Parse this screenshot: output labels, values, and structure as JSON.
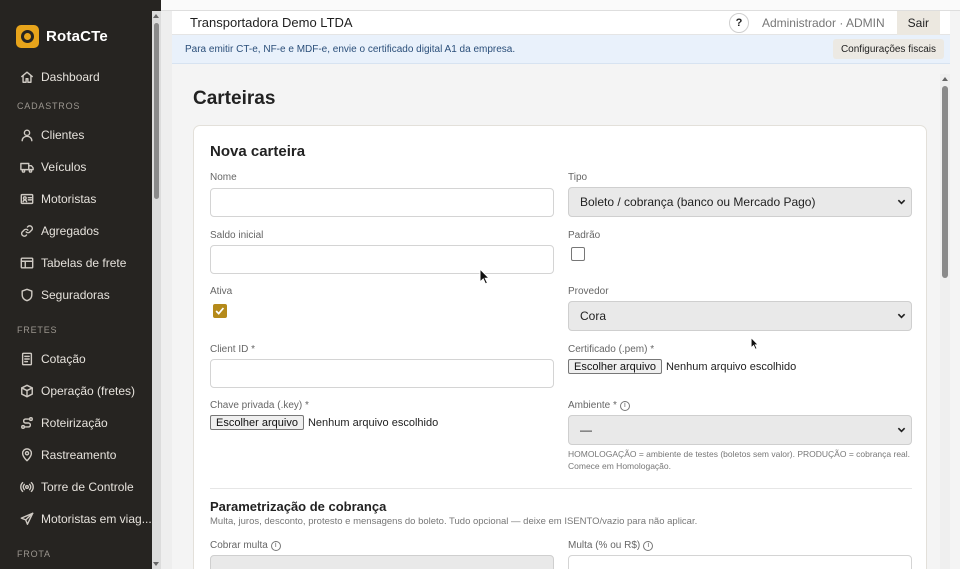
{
  "brand": {
    "name": "RotaCTe"
  },
  "sidebar": {
    "items_top": [
      {
        "label": "Dashboard",
        "icon": "home-icon"
      }
    ],
    "section_cadastros": "CADASTROS",
    "cadastros": [
      {
        "label": "Clientes",
        "icon": "user-icon"
      },
      {
        "label": "Veículos",
        "icon": "truck-icon"
      },
      {
        "label": "Motoristas",
        "icon": "id-card-icon"
      },
      {
        "label": "Agregados",
        "icon": "link-icon"
      },
      {
        "label": "Tabelas de frete",
        "icon": "table-icon"
      },
      {
        "label": "Seguradoras",
        "icon": "shield-icon"
      }
    ],
    "section_fretes": "FRETES",
    "fretes": [
      {
        "label": "Cotação",
        "icon": "document-icon"
      },
      {
        "label": "Operação (fretes)",
        "icon": "box-icon"
      },
      {
        "label": "Roteirização",
        "icon": "route-icon"
      },
      {
        "label": "Rastreamento",
        "icon": "map-pin-icon"
      },
      {
        "label": "Torre de Controle",
        "icon": "broadcast-icon"
      },
      {
        "label": "Motoristas em viag...",
        "icon": "send-icon"
      }
    ],
    "section_frota": "FROTA"
  },
  "topbar": {
    "company": "Transportadora Demo LTDA",
    "help": "?",
    "user": "Administrador · ADMIN",
    "logout": "Sair"
  },
  "notice": {
    "text": "Para emitir CT-e, NF-e e MDF-e, envie o certificado digital A1 da empresa.",
    "button": "Configurações fiscais"
  },
  "page": {
    "title": "Carteiras"
  },
  "form": {
    "title": "Nova carteira",
    "nome_label": "Nome",
    "nome_value": "",
    "tipo_label": "Tipo",
    "tipo_value": "Boleto / cobrança (banco ou Mercado Pago)",
    "saldo_label": "Saldo inicial",
    "saldo_value": "",
    "padrao_label": "Padrão",
    "padrao_checked": false,
    "ativa_label": "Ativa",
    "ativa_checked": true,
    "provedor_label": "Provedor",
    "provedor_value": "Cora",
    "client_id_label": "Client ID *",
    "client_id_value": "",
    "certificado_label": "Certificado (.pem) *",
    "file_button": "Escolher arquivo",
    "file_status": "Nenhum arquivo escolhido",
    "chave_label": "Chave privada (.key) *",
    "ambiente_label": "Ambiente *",
    "ambiente_value": "—",
    "ambiente_hint": "HOMOLOGAÇÃO = ambiente de testes (boletos sem valor). PRODUÇÃO = cobrança real. Comece em Homologação.",
    "param_title": "Parametrização de cobrança",
    "param_sub": "Multa, juros, desconto, protesto e mensagens do boleto. Tudo opcional — deixe em ISENTO/vazio para não aplicar.",
    "cobrar_multa_label": "Cobrar multa",
    "multa_label": "Multa (% ou R$)"
  }
}
